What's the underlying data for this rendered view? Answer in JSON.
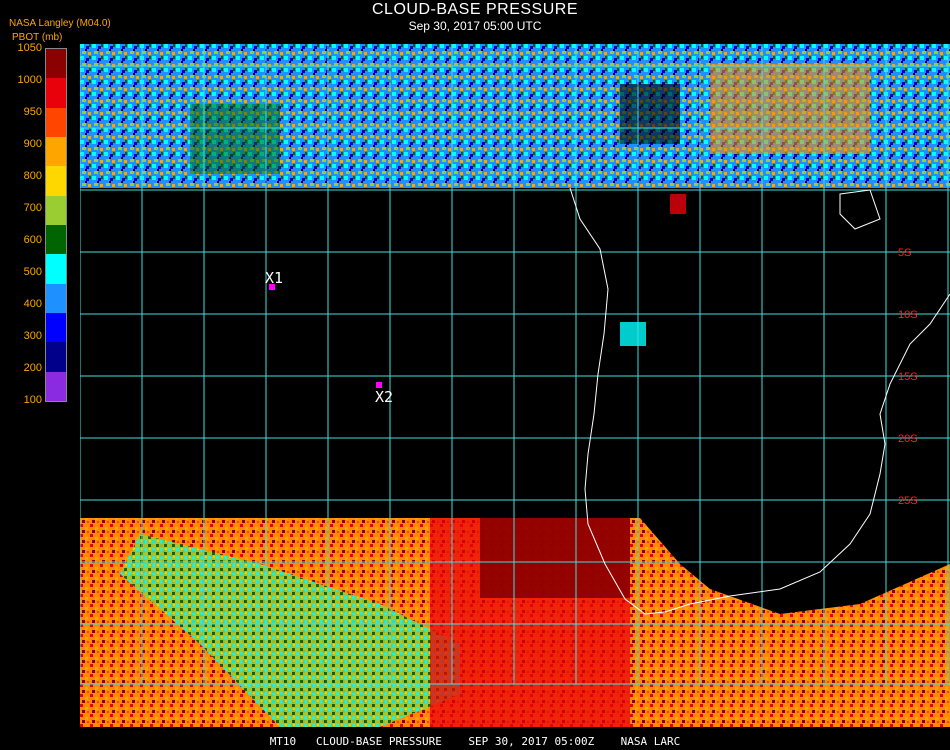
{
  "header": {
    "title": "CLOUD-BASE PRESSURE",
    "subtitle": "Sep 30, 2017 05:00 UTC",
    "org": "NASA Langley (M04.0)",
    "units": "PBOT (mb)"
  },
  "legend": {
    "ticks": [
      "1050",
      "1000",
      "950",
      "900",
      "800",
      "700",
      "600",
      "500",
      "400",
      "300",
      "200",
      "100"
    ],
    "colors": [
      "#8b0000",
      "#e8000b",
      "#ff4500",
      "#ffa500",
      "#ffd700",
      "#9acd32",
      "#006400",
      "#00ffff",
      "#1e90ff",
      "#0000ff",
      "#00008b",
      "#8a2be2"
    ]
  },
  "map": {
    "lat_labels": [
      "5S",
      "10S",
      "15S",
      "20S",
      "25S"
    ],
    "markers": [
      {
        "label": "X1"
      },
      {
        "label": "X2"
      }
    ],
    "colors": {
      "grid": "#40e0e0",
      "coast": "#ffffff",
      "lat_label": "#ff2020",
      "marker": "#ff00ff"
    }
  },
  "footer": "MT10   CLOUD-BASE PRESSURE    SEP 30, 2017 05:00Z    NASA LARC"
}
